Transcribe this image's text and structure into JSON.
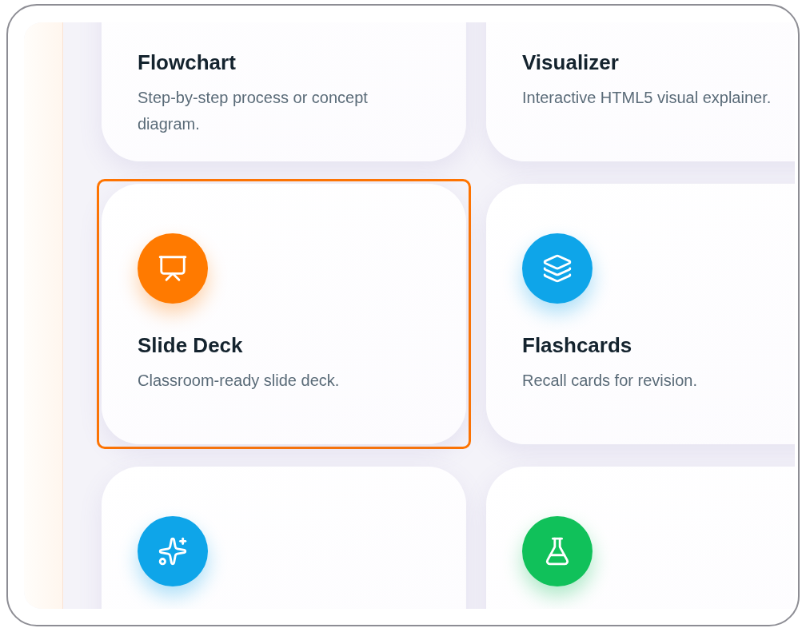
{
  "cards": [
    {
      "title": "Flowchart",
      "description": "Step-by-step process or concept diagram.",
      "selected": false
    },
    {
      "title": "Visualizer",
      "description": "Interactive HTML5 visual explainer.",
      "selected": false
    },
    {
      "title": "Slide Deck",
      "description": "Classroom-ready slide deck.",
      "selected": true,
      "kind": "presentation",
      "color": "#ff7a00"
    },
    {
      "title": "Flashcards",
      "description": "Recall cards for revision.",
      "selected": false,
      "kind": "layers",
      "color": "#0ea5e9"
    },
    {
      "selected": false,
      "kind": "sparkles",
      "color": "#0ea5e9"
    },
    {
      "selected": false,
      "kind": "flask",
      "color": "#10c15a"
    }
  ]
}
